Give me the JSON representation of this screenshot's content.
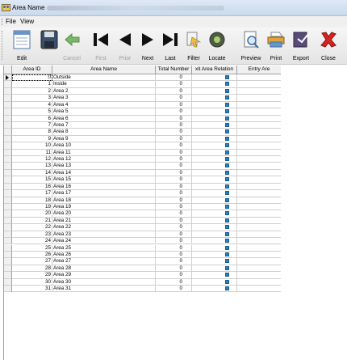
{
  "window": {
    "title": "Area Name"
  },
  "menu": {
    "file_label": "File",
    "view_label": "View"
  },
  "toolbar": {
    "edit": "Edit",
    "save": "",
    "cancel": "Cancel",
    "first": "First",
    "prior": "Prior",
    "next": "Next",
    "last": "Last",
    "filter": "Filter",
    "locate": "Locate",
    "preview": "Preview",
    "print": "Print",
    "export": "Export",
    "close": "Close"
  },
  "grid": {
    "headers": {
      "area_id": "Area ID",
      "area_name": "Area Name",
      "total_number": "Total Number",
      "area_relation": "xit Area Relation",
      "entry_area": "Entry Are"
    },
    "rows": [
      {
        "id": "0",
        "name": "Outside",
        "total": "0"
      },
      {
        "id": "1",
        "name": "Inside",
        "total": "0"
      },
      {
        "id": "2",
        "name": "Area 2",
        "total": "0"
      },
      {
        "id": "3",
        "name": "Area 3",
        "total": "0"
      },
      {
        "id": "4",
        "name": "Area 4",
        "total": "0"
      },
      {
        "id": "5",
        "name": "Area 5",
        "total": "0"
      },
      {
        "id": "6",
        "name": "Area 6",
        "total": "0"
      },
      {
        "id": "7",
        "name": "Area 7",
        "total": "0"
      },
      {
        "id": "8",
        "name": "Area 8",
        "total": "0"
      },
      {
        "id": "9",
        "name": "Area 9",
        "total": "0"
      },
      {
        "id": "10",
        "name": "Area 10",
        "total": "0"
      },
      {
        "id": "11",
        "name": "Area 11",
        "total": "0"
      },
      {
        "id": "12",
        "name": "Area 12",
        "total": "0"
      },
      {
        "id": "13",
        "name": "Area 13",
        "total": "0"
      },
      {
        "id": "14",
        "name": "Area 14",
        "total": "0"
      },
      {
        "id": "15",
        "name": "Area 15",
        "total": "0"
      },
      {
        "id": "16",
        "name": "Area 16",
        "total": "0"
      },
      {
        "id": "17",
        "name": "Area 17",
        "total": "0"
      },
      {
        "id": "18",
        "name": "Area 18",
        "total": "0"
      },
      {
        "id": "19",
        "name": "Area 19",
        "total": "0"
      },
      {
        "id": "20",
        "name": "Area 20",
        "total": "0"
      },
      {
        "id": "21",
        "name": "Area 21",
        "total": "0"
      },
      {
        "id": "22",
        "name": "Area 22",
        "total": "0"
      },
      {
        "id": "23",
        "name": "Area 23",
        "total": "0"
      },
      {
        "id": "24",
        "name": "Area 24",
        "total": "0"
      },
      {
        "id": "25",
        "name": "Area 25",
        "total": "0"
      },
      {
        "id": "26",
        "name": "Area 26",
        "total": "0"
      },
      {
        "id": "27",
        "name": "Area 27",
        "total": "0"
      },
      {
        "id": "28",
        "name": "Area 28",
        "total": "0"
      },
      {
        "id": "29",
        "name": "Area 29",
        "total": "0"
      },
      {
        "id": "30",
        "name": "Area 30",
        "total": "0"
      },
      {
        "id": "31",
        "name": "Area 31",
        "total": "0"
      }
    ]
  },
  "colors": {
    "relation_flag": "#2b7fbf"
  }
}
